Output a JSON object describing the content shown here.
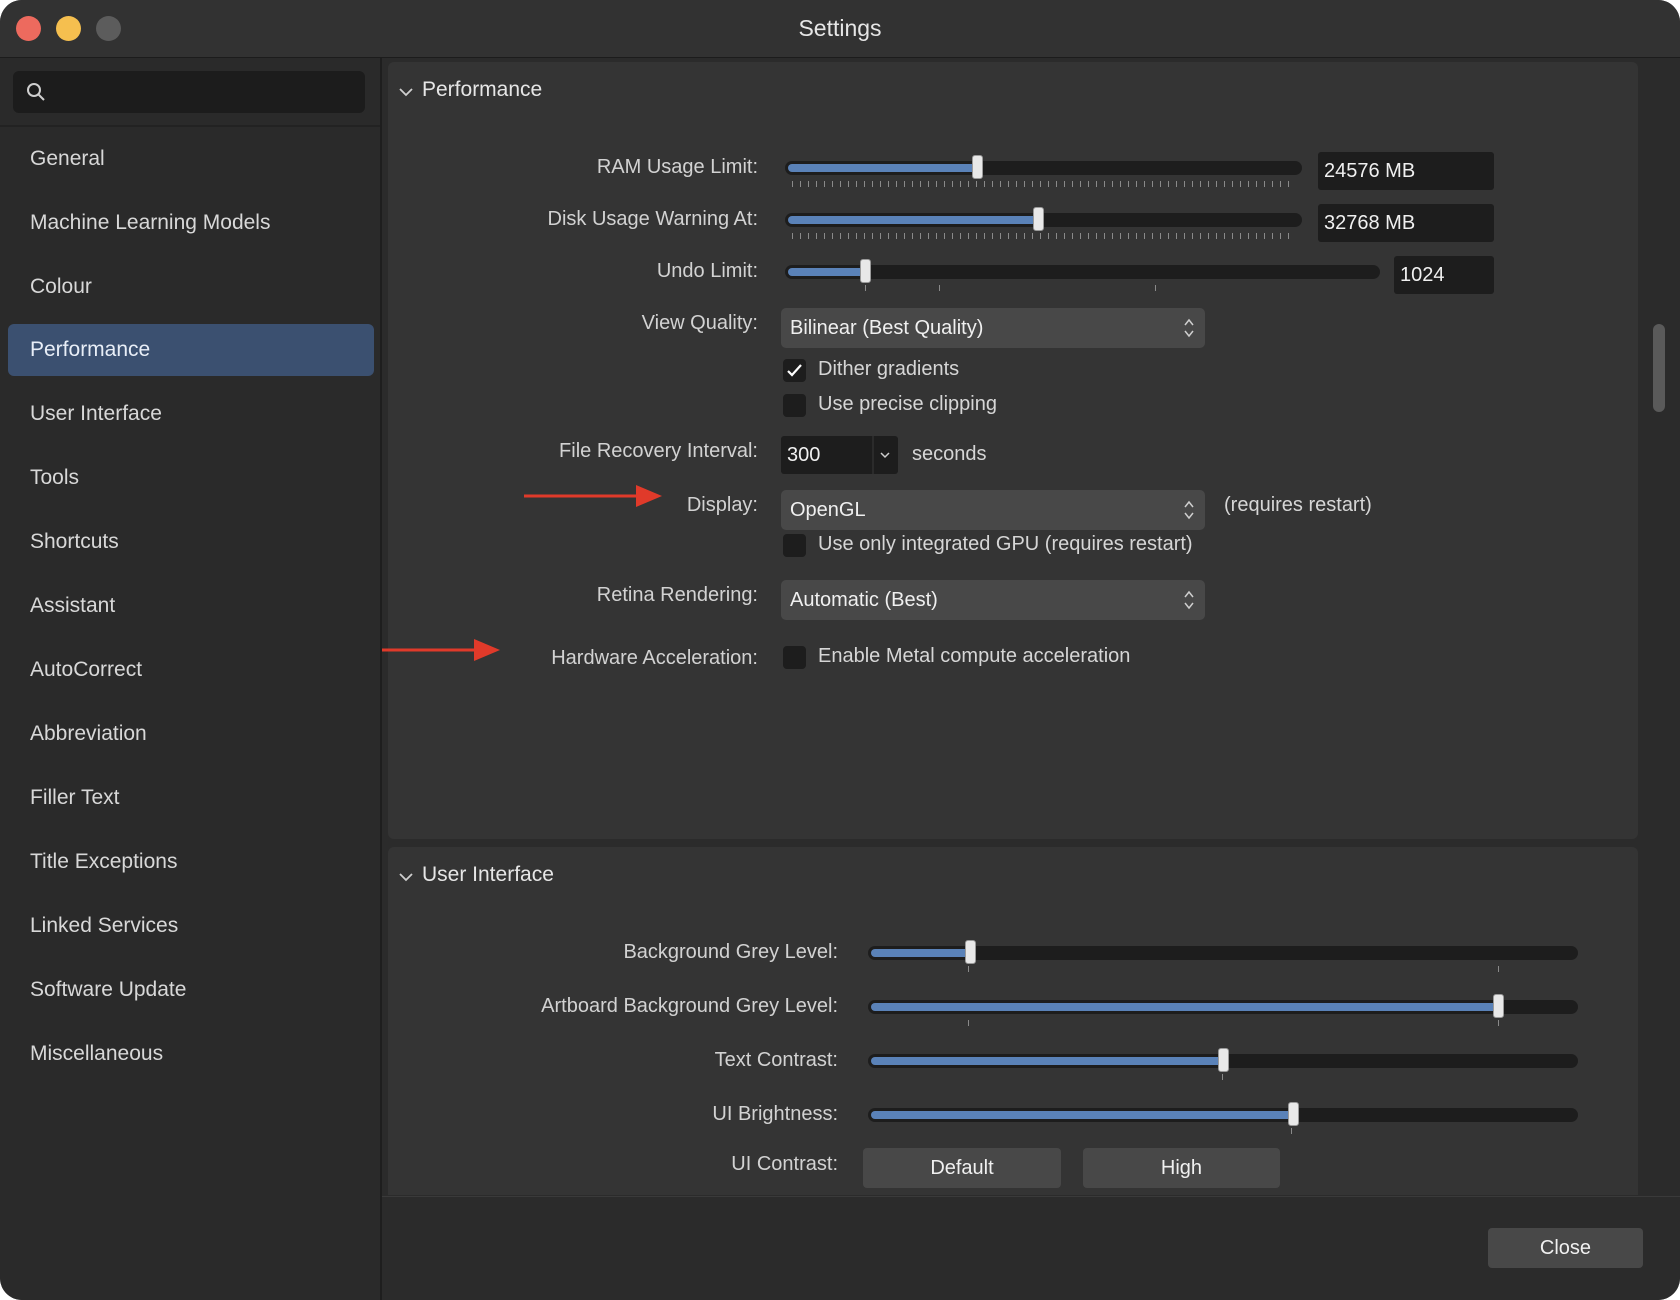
{
  "window": {
    "title": "Settings"
  },
  "sidebar": {
    "search_placeholder": "",
    "items": [
      {
        "label": "General"
      },
      {
        "label": "Machine Learning Models"
      },
      {
        "label": "Colour"
      },
      {
        "label": "Performance"
      },
      {
        "label": "User Interface"
      },
      {
        "label": "Tools"
      },
      {
        "label": "Shortcuts"
      },
      {
        "label": "Assistant"
      },
      {
        "label": "AutoCorrect"
      },
      {
        "label": "Abbreviation"
      },
      {
        "label": "Filler Text"
      },
      {
        "label": "Title Exceptions"
      },
      {
        "label": "Linked Services"
      },
      {
        "label": "Software Update"
      },
      {
        "label": "Miscellaneous"
      }
    ],
    "selected": "Performance"
  },
  "performance": {
    "section_title": "Performance",
    "ram": {
      "label": "RAM Usage Limit:",
      "value": "24576 MB",
      "level": 0.37
    },
    "disk": {
      "label": "Disk Usage Warning At:",
      "value": "32768 MB",
      "level": 0.49
    },
    "undo": {
      "label": "Undo Limit:",
      "value": "1024",
      "level": 0.13
    },
    "view_quality": {
      "label": "View Quality:",
      "value": "Bilinear (Best Quality)"
    },
    "dither": {
      "label": "Dither gradients",
      "checked": true
    },
    "precise_clipping": {
      "label": "Use precise clipping",
      "checked": false
    },
    "file_recovery": {
      "label": "File Recovery Interval:",
      "value": "300",
      "unit": "seconds"
    },
    "display": {
      "label": "Display:",
      "value": "OpenGL",
      "note": "(requires restart)"
    },
    "integrated_gpu": {
      "label": "Use only integrated GPU (requires restart)",
      "checked": false
    },
    "retina": {
      "label": "Retina Rendering:",
      "value": "Automatic (Best)"
    },
    "hardware_accel": {
      "label": "Hardware Acceleration:",
      "option": "Enable Metal compute acceleration",
      "checked": false
    }
  },
  "user_interface": {
    "section_title": "User Interface",
    "background_grey": {
      "label": "Background Grey Level:",
      "level": 0.14
    },
    "artboard_grey": {
      "label": "Artboard Background Grey Level:",
      "level": 0.89
    },
    "text_contrast": {
      "label": "Text Contrast:",
      "level": 0.5
    },
    "ui_brightness": {
      "label": "UI Brightness:",
      "level": 0.6
    },
    "ui_contrast": {
      "label": "UI Contrast:",
      "options": [
        "Default",
        "High"
      ]
    }
  },
  "footer": {
    "close_label": "Close"
  },
  "annotation_color": "#e03a2a"
}
